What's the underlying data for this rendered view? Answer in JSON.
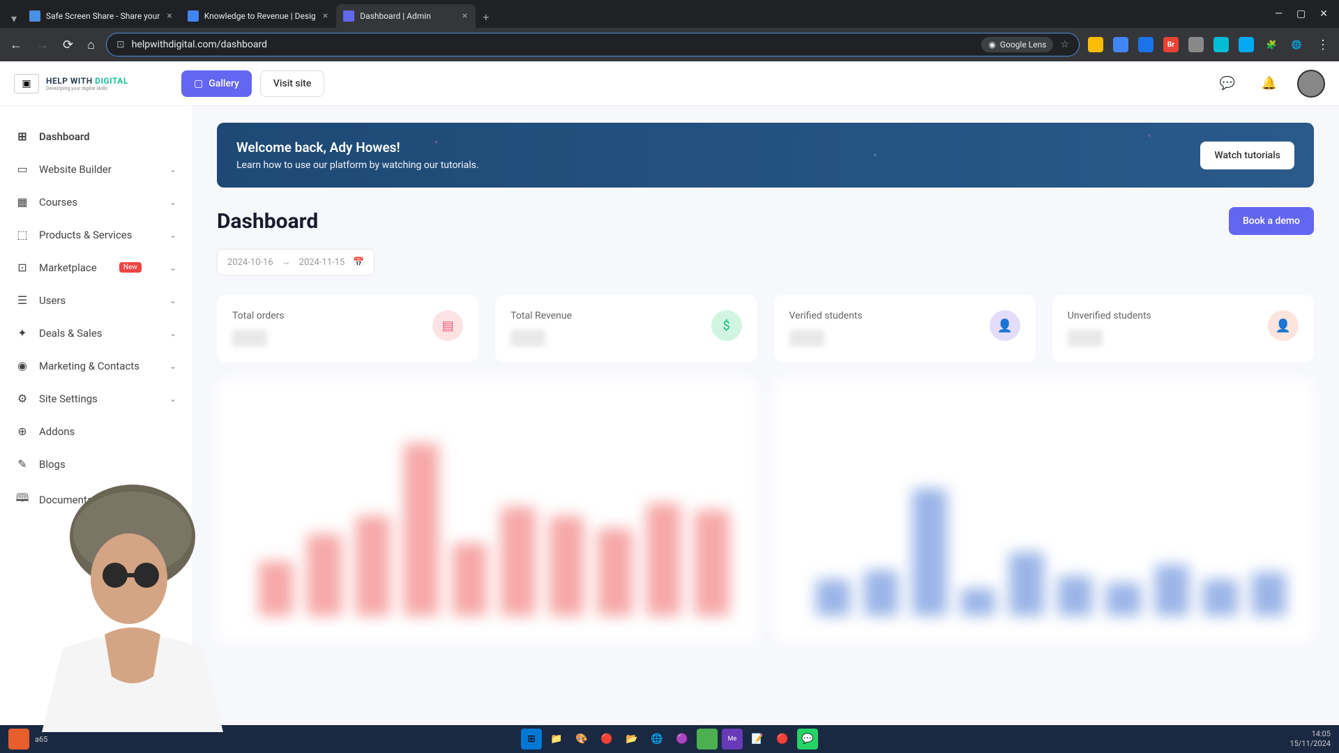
{
  "browser": {
    "tabs": [
      {
        "title": "Safe Screen Share - Share your",
        "active": false
      },
      {
        "title": "Knowledge to Revenue | Desig",
        "active": false
      },
      {
        "title": "Dashboard | Admin",
        "active": true
      }
    ],
    "url": "helpwithdigital.com/dashboard",
    "lens_label": "Google Lens"
  },
  "logo": {
    "line1a": "HELP WITH",
    "line1b": "DIGITAL",
    "line2": "Developing your digital skills"
  },
  "header": {
    "gallery_label": "Gallery",
    "visit_label": "Visit site"
  },
  "sidebar": {
    "items": [
      {
        "label": "Dashboard",
        "icon": "⊞",
        "active": true,
        "expandable": false
      },
      {
        "label": "Website Builder",
        "icon": "▭",
        "expandable": true
      },
      {
        "label": "Courses",
        "icon": "▦",
        "expandable": true
      },
      {
        "label": "Products & Services",
        "icon": "⬚",
        "expandable": true
      },
      {
        "label": "Marketplace",
        "icon": "⊡",
        "expandable": true,
        "badge": "New"
      },
      {
        "label": "Users",
        "icon": "☰",
        "expandable": true
      },
      {
        "label": "Deals & Sales",
        "icon": "✦",
        "expandable": true
      },
      {
        "label": "Marketing & Contacts",
        "icon": "◉",
        "expandable": true
      },
      {
        "label": "Site Settings",
        "icon": "⚙",
        "expandable": true
      },
      {
        "label": "Addons",
        "icon": "⊕",
        "expandable": false
      },
      {
        "label": "Blogs",
        "icon": "✎",
        "expandable": false
      },
      {
        "label": "Documentation",
        "icon": "🕮",
        "expandable": false
      }
    ]
  },
  "banner": {
    "title": "Welcome back, Ady Howes!",
    "subtitle": "Learn how to use our platform by watching our tutorials.",
    "button": "Watch tutorials"
  },
  "page": {
    "title": "Dashboard",
    "book_demo": "Book a demo",
    "date_from": "2024-10-16",
    "date_to": "2024-11-15"
  },
  "stats": [
    {
      "label": "Total orders",
      "icon_class": "pink",
      "icon": "▤"
    },
    {
      "label": "Total Revenue",
      "icon_class": "green",
      "icon": "$"
    },
    {
      "label": "Verified students",
      "icon_class": "purple",
      "icon": "👤"
    },
    {
      "label": "Unverified students",
      "icon_class": "peach",
      "icon": "👤"
    }
  ],
  "chart_data": [
    {
      "type": "bar",
      "note": "blurred/obscured in screenshot",
      "bars_relative_heights": [
        30,
        45,
        55,
        95,
        40,
        60,
        55,
        48,
        62,
        58
      ]
    },
    {
      "type": "bar",
      "note": "blurred/obscured in screenshot",
      "bars_relative_heights": [
        20,
        25,
        70,
        15,
        35,
        22,
        18,
        28,
        20,
        24
      ]
    }
  ],
  "taskbar": {
    "user_hint": "a65",
    "time": "14:05",
    "date": "15/11/2024"
  }
}
